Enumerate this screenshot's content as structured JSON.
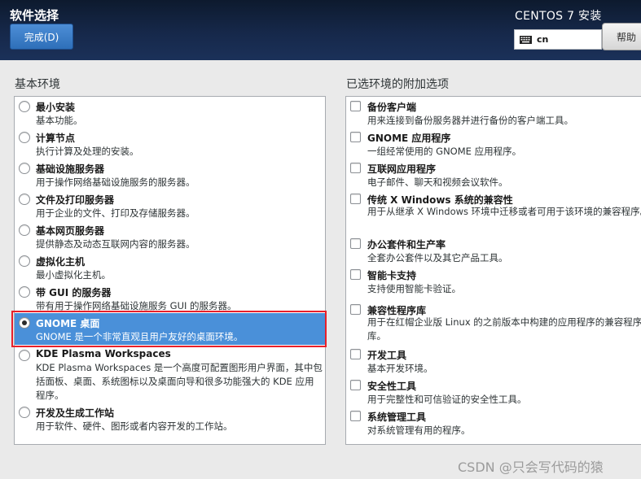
{
  "header": {
    "spoke_title": "软件选择",
    "done_label": "完成(D)",
    "product_title": "CENTOS 7 安装",
    "keyboard_layout": "cn",
    "help_label": "帮助"
  },
  "base_env": {
    "title": "基本环境",
    "items": [
      {
        "title": "最小安装",
        "desc": "基本功能。",
        "selected": false
      },
      {
        "title": "计算节点",
        "desc": "执行计算及处理的安装。",
        "selected": false
      },
      {
        "title": "基础设施服务器",
        "desc": "用于操作网络基础设施服务的服务器。",
        "selected": false
      },
      {
        "title": "文件及打印服务器",
        "desc": "用于企业的文件、打印及存储服务器。",
        "selected": false
      },
      {
        "title": "基本网页服务器",
        "desc": "提供静态及动态互联网内容的服务器。",
        "selected": false
      },
      {
        "title": "虚拟化主机",
        "desc": "最小虚拟化主机。",
        "selected": false
      },
      {
        "title": "带 GUI 的服务器",
        "desc": "带有用于操作网络基础设施服务 GUI 的服务器。",
        "selected": false
      },
      {
        "title": "GNOME 桌面",
        "desc": "GNOME 是一个非常直观且用户友好的桌面环境。",
        "selected": true
      },
      {
        "title": "KDE Plasma Workspaces",
        "desc": "KDE Plasma Workspaces 是一个高度可配置图形用户界面，其中包括面板、桌面、系统图标以及桌面向导和很多功能强大的 KDE 应用程序。",
        "selected": false
      },
      {
        "title": "开发及生成工作站",
        "desc": "用于软件、硬件、图形或者内容开发的工作站。",
        "selected": false
      }
    ]
  },
  "addons": {
    "title": "已选环境的附加选项",
    "items": [
      {
        "title": "备份客户端",
        "desc": "用来连接到备份服务器并进行备份的客户端工具。",
        "checked": false
      },
      {
        "title": "GNOME 应用程序",
        "desc": "一组经常使用的 GNOME 应用程序。",
        "checked": false
      },
      {
        "title": "互联网应用程序",
        "desc": "电子邮件、聊天和视频会议软件。",
        "checked": false
      },
      {
        "title": "传统 X Windows 系统的兼容性",
        "desc": "用于从继承 X Windows 环境中迁移或者可用于该环境的兼容程序。",
        "checked": false
      },
      {
        "title": "办公套件和生产率",
        "desc": "全套办公套件以及其它产品工具。",
        "checked": false
      },
      {
        "title": "智能卡支持",
        "desc": "支持使用智能卡验证。",
        "checked": false
      },
      {
        "title": "兼容性程序库",
        "desc": "用于在红帽企业版 Linux 的之前版本中构建的应用程序的兼容程序库。",
        "checked": false
      },
      {
        "title": "开发工具",
        "desc": "基本开发环境。",
        "checked": false
      },
      {
        "title": "安全性工具",
        "desc": "用于完整性和可信验证的安全性工具。",
        "checked": false
      },
      {
        "title": "系统管理工具",
        "desc": "对系统管理有用的程序。",
        "checked": false
      }
    ]
  },
  "watermark": "CSDN @只会写代码的猿",
  "colors": {
    "header_bg": "#16284a",
    "done_button": "#2e6fb9",
    "selection": "#4a90d9",
    "highlight_box": "#e8202a"
  },
  "icons": {
    "keyboard": "keyboard-icon"
  }
}
